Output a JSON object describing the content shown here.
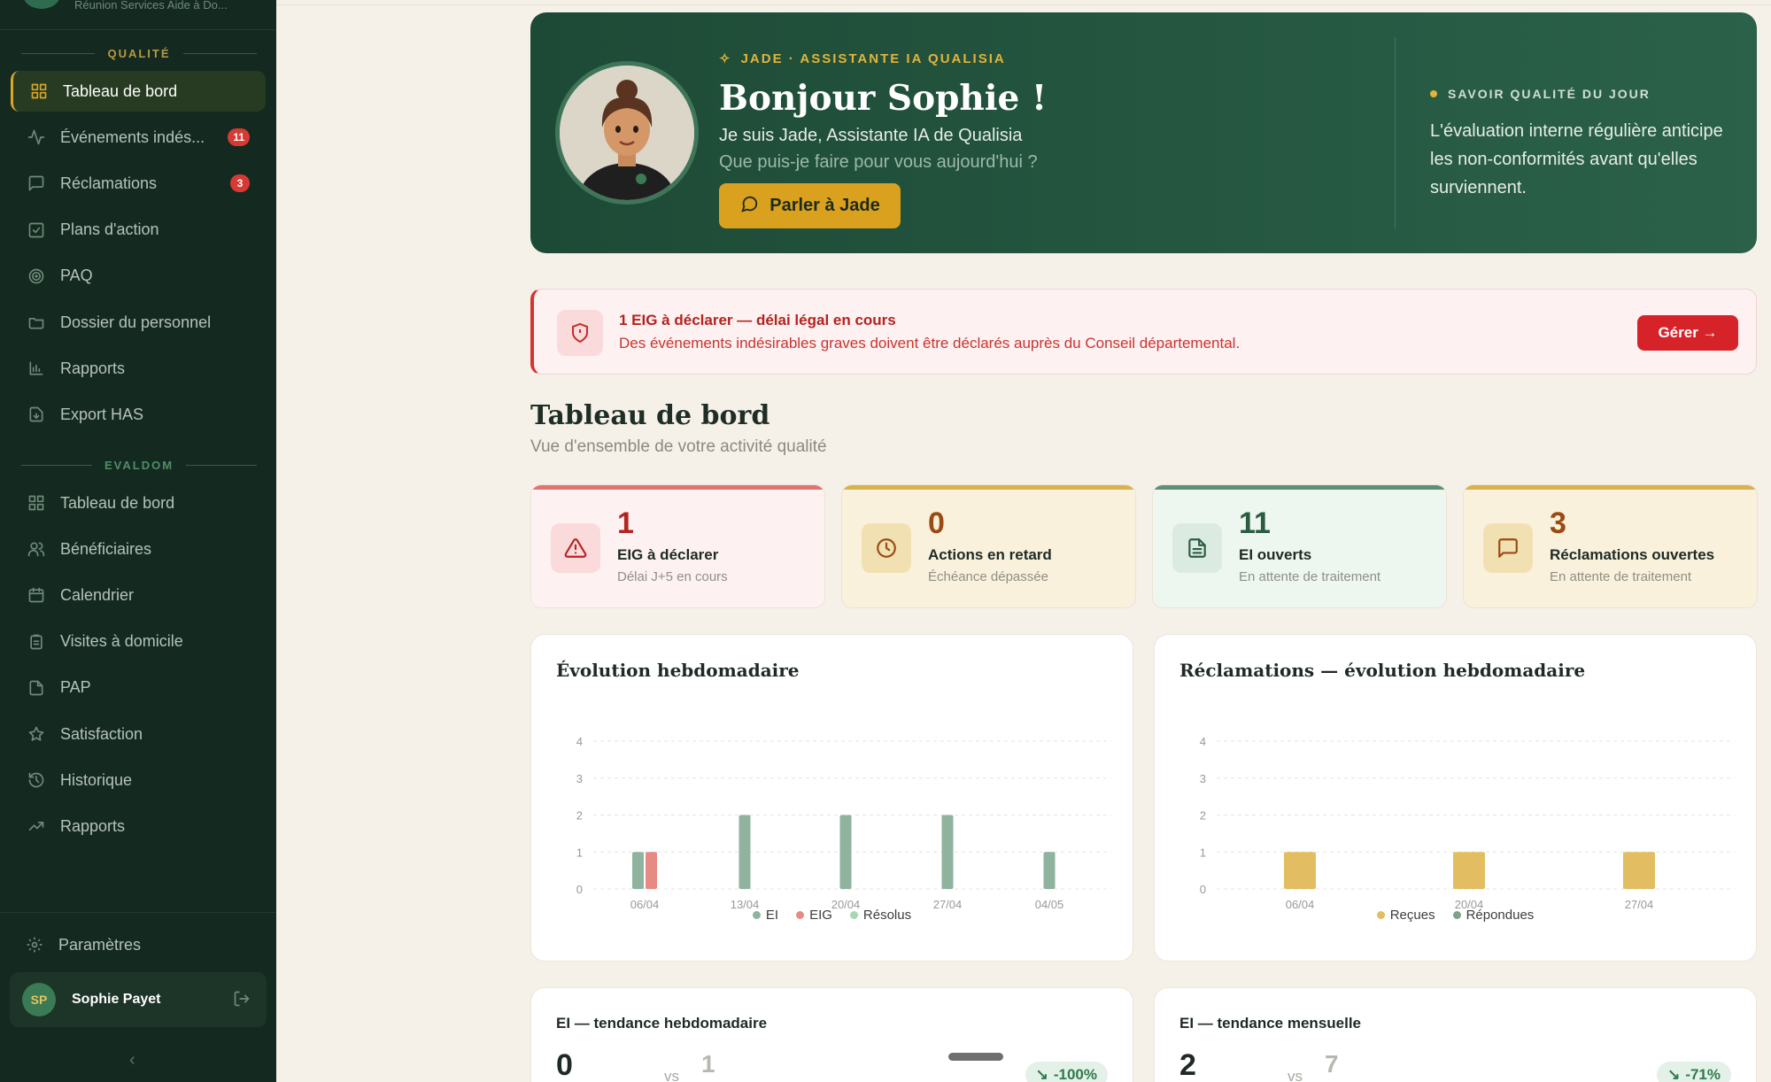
{
  "sidebar": {
    "org_name": "Réunion Services Aide à Do...",
    "section_quality": "QUALITÉ",
    "section_evaldom": "EVALDOM",
    "quality_items": [
      {
        "label": "Tableau de bord",
        "icon": "grid-icon",
        "active": true
      },
      {
        "label": "Événements indés...",
        "icon": "activity-icon",
        "badge": "11"
      },
      {
        "label": "Réclamations",
        "icon": "message-square-icon",
        "badge": "3"
      },
      {
        "label": "Plans d'action",
        "icon": "checkbox-icon"
      },
      {
        "label": "PAQ",
        "icon": "target-icon"
      },
      {
        "label": "Dossier du personnel",
        "icon": "folder-open-icon"
      },
      {
        "label": "Rapports",
        "icon": "bar-chart-icon"
      },
      {
        "label": "Export HAS",
        "icon": "file-download-icon"
      }
    ],
    "evaldom_items": [
      {
        "label": "Tableau de bord",
        "icon": "grid-icon"
      },
      {
        "label": "Bénéficiaires",
        "icon": "users-icon"
      },
      {
        "label": "Calendrier",
        "icon": "calendar-icon"
      },
      {
        "label": "Visites à domicile",
        "icon": "clipboard-icon"
      },
      {
        "label": "PAP",
        "icon": "file-icon"
      },
      {
        "label": "Satisfaction",
        "icon": "star-icon"
      },
      {
        "label": "Historique",
        "icon": "history-icon"
      },
      {
        "label": "Rapports",
        "icon": "trending-up-icon"
      }
    ],
    "settings_label": "Paramètres",
    "user": {
      "initials": "SP",
      "name": "Sophie Payet"
    }
  },
  "hero": {
    "kicker": "JADE · ASSISTANTE IA QUALISIA",
    "greeting": "Bonjour Sophie !",
    "intro": "Je suis Jade, Assistante IA de Qualisia",
    "question": "Que puis-je faire pour vous aujourd'hui ?",
    "cta_label": "Parler à Jade",
    "tip_kicker": "SAVOIR QUALITÉ DU JOUR",
    "tip_text": "L'évaluation interne régulière anticipe les non-conformités avant qu'elles surviennent."
  },
  "alert": {
    "title": "1 EIG à déclarer — délai légal en cours",
    "text": "Des événements indésirables graves doivent être déclarés auprès du Conseil départemental.",
    "button": "Gérer →"
  },
  "page": {
    "title": "Tableau de bord",
    "subtitle": "Vue d'ensemble de votre activité qualité"
  },
  "kpis": [
    {
      "value": "1",
      "label": "EIG à déclarer",
      "sub": "Délai J+5 en cours",
      "icon": "alert-triangle-icon",
      "accent": "#e07470",
      "bg": "#fdf2f1",
      "value_color": "#b4231f"
    },
    {
      "value": "0",
      "label": "Actions en retard",
      "sub": "Échéance dépassée",
      "icon": "clock-icon",
      "accent": "#d9b24e",
      "bg": "#f9f1dc",
      "value_color": "#9a4a12"
    },
    {
      "value": "11",
      "label": "EI ouverts",
      "sub": "En attente de traitement",
      "icon": "file-text-icon",
      "accent": "#5f8f76",
      "bg": "#eef6f0",
      "value_color": "#2b5c42"
    },
    {
      "value": "3",
      "label": "Réclamations ouvertes",
      "sub": "En attente de traitement",
      "icon": "message-square-icon",
      "accent": "#d9b24e",
      "bg": "#f9f1dc",
      "value_color": "#9a4a12"
    }
  ],
  "chart_data": [
    {
      "type": "bar",
      "title": "Évolution hebdomadaire",
      "categories": [
        "06/04",
        "13/04",
        "20/04",
        "27/04",
        "04/05"
      ],
      "series": [
        {
          "name": "EI",
          "values": [
            1,
            2,
            2,
            2,
            1
          ],
          "color": "#8fb39e"
        },
        {
          "name": "EIG",
          "values": [
            1,
            0,
            0,
            0,
            0
          ],
          "color": "#e88a84"
        },
        {
          "name": "Résolus",
          "values": [
            0,
            0,
            0,
            0,
            0
          ],
          "color": "#a6d9b3"
        }
      ],
      "ylim": [
        0,
        4
      ],
      "yticks": [
        "0",
        "1",
        "2",
        "3",
        "4"
      ],
      "grid": true,
      "legend": "bottom"
    },
    {
      "type": "bar",
      "title": "Réclamations — évolution hebdomadaire",
      "categories": [
        "06/04",
        "20/04",
        "27/04"
      ],
      "series": [
        {
          "name": "Reçues",
          "values": [
            1,
            1,
            1
          ],
          "color": "#e2bd62"
        },
        {
          "name": "Répondues",
          "values": [
            0,
            0,
            0
          ],
          "color": "#7fa08d"
        }
      ],
      "ylim": [
        0,
        4
      ],
      "yticks": [
        "0",
        "1",
        "2",
        "3",
        "4"
      ],
      "grid": true,
      "legend": "bottom"
    }
  ],
  "trends": [
    {
      "title": "EI — tendance hebdomadaire",
      "current": "0",
      "vs": "vs",
      "previous": "1",
      "change": "-100%"
    },
    {
      "title": "EI — tendance mensuelle",
      "current": "2",
      "vs": "vs",
      "previous": "7",
      "change": "-71%"
    }
  ]
}
